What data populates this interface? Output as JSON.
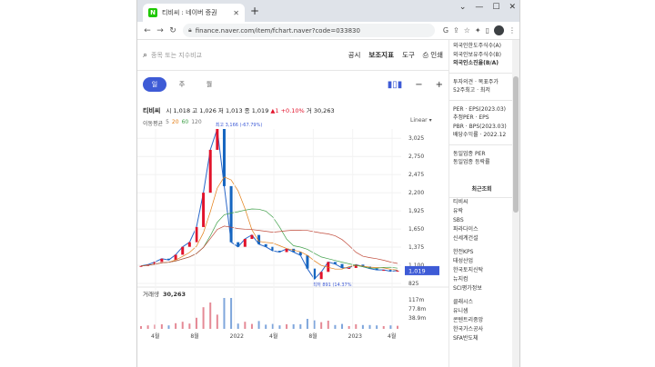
{
  "browser": {
    "tab_title": "티비씨 : 네이버 증권",
    "url": "finance.naver.com/item/fchart.naver?code=033830"
  },
  "toolbar": {
    "search_placeholder": "종목 또는 지수비교",
    "items": [
      "공시",
      "보조지표",
      "도구",
      "인쇄"
    ]
  },
  "periods": [
    "일",
    "주",
    "월"
  ],
  "quote": {
    "name": "티비씨",
    "open_label": "시",
    "open": "1,018",
    "high_label": "고",
    "high": "1,026",
    "low_label": "저",
    "low": "1,013",
    "close_label": "종",
    "close": "1,019",
    "change": "▲1 +0.10%",
    "volume_label": "거",
    "volume": "30,263"
  },
  "ma": {
    "label": "이동평균",
    "p1": "5",
    "p2": "20",
    "p3": "60",
    "p4": "120"
  },
  "chart_data": {
    "type": "line",
    "scale": "Linear",
    "y_ticks": [
      "3,025",
      "2,750",
      "2,475",
      "2,200",
      "1,925",
      "1,650",
      "1,375",
      "1,100",
      "825"
    ],
    "x_ticks": [
      "4월",
      "8월",
      "2022",
      "4월",
      "8월",
      "2023",
      "4월"
    ],
    "current_price": "1,019",
    "max_annotation": "최고 3,166 (-67.79%)",
    "min_annotation": "최저 891 (14.37%)",
    "ylim": [
      825,
      3166
    ],
    "series": [
      {
        "name": "",
        "values": [
          1090,
          1110,
          1150,
          1200,
          1180,
          1260,
          1380,
          1450,
          1680,
          2200,
          2850,
          3166,
          2300,
          1450,
          1380,
          1500,
          1560,
          1420,
          1380,
          1320,
          1300,
          1350,
          1300,
          1250,
          1050,
          891,
          1000,
          1150,
          1120,
          1060,
          1060,
          1110,
          1080,
          1050,
          1030,
          1030,
          1010,
          1019
        ]
      }
    ],
    "volume": {
      "label": "거래량",
      "value": "30,263",
      "ticks": [
        "117m",
        "77.8m",
        "38.9m"
      ]
    }
  },
  "sidebar": {
    "top": [
      "외국인한도주식수(A)",
      "외국인보유주식수(B)",
      "외국인소진율(B/A)"
    ],
    "mid": [
      "투자의견 · 목표주가",
      "52주최고 · 최저"
    ],
    "per": [
      "PER · EPS(2023.03)",
      "추정PER · EPS",
      "PBR · BPS(2023.03)",
      "배당수익률 · 2022.12"
    ],
    "industry": [
      "동일업종 PER",
      "동일업종 등락률"
    ],
    "recent_head": "최근조회",
    "recent": [
      "티비씨",
      "유락",
      "SBS",
      "파라다이스",
      "신세계건설",
      "",
      "한전KPS",
      "태성산업",
      "한국토지신탁",
      "뉴지컴",
      "SCI평가정보",
      "",
      "클래시스",
      "유니셈",
      "콘텐트리중앙",
      "한국가스공사",
      "SFA반도체"
    ]
  },
  "colors": {
    "accent": "#3e5bd6",
    "up": "#e2132b",
    "down": "#1565c0"
  }
}
